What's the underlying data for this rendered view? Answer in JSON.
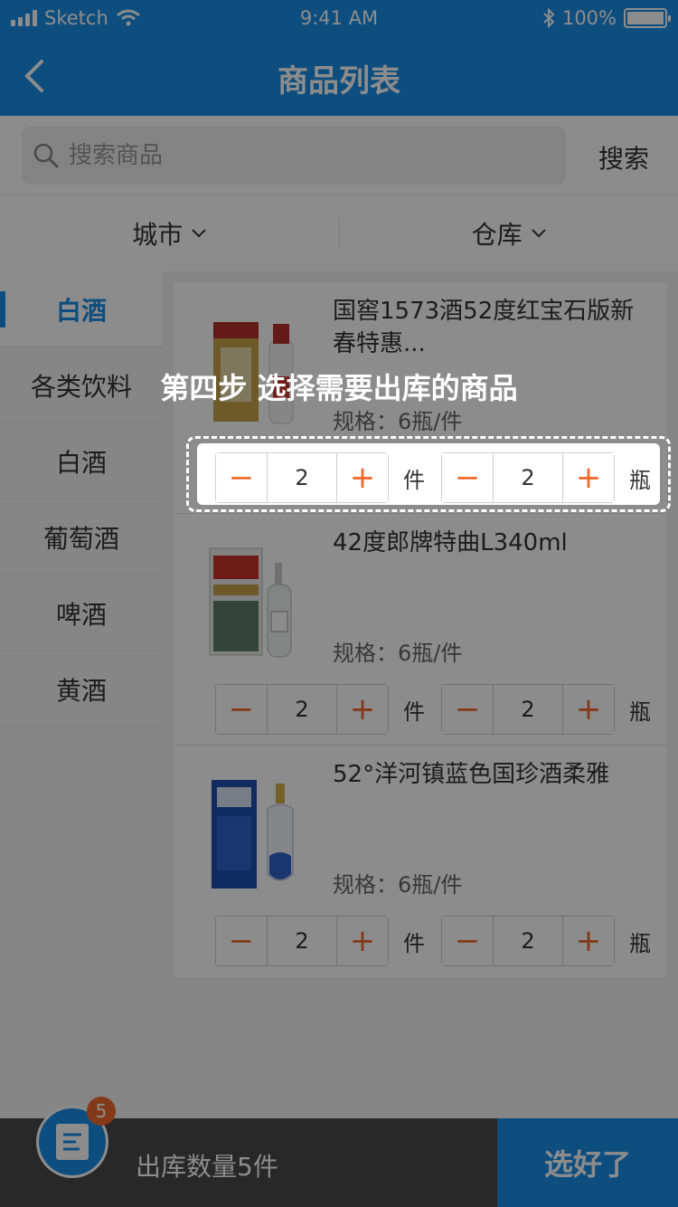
{
  "status": {
    "carrier": "Sketch",
    "time": "9:41 AM",
    "battery": "100%"
  },
  "nav": {
    "title": "商品列表"
  },
  "search": {
    "placeholder": "搜索商品",
    "button_label": "搜索"
  },
  "filters": [
    {
      "label": "城市"
    },
    {
      "label": "仓库"
    }
  ],
  "categories": [
    {
      "label": "白酒",
      "active": true
    },
    {
      "label": "各类饮料"
    },
    {
      "label": "白酒"
    },
    {
      "label": "葡萄酒"
    },
    {
      "label": "啤酒"
    },
    {
      "label": "黄酒"
    }
  ],
  "products": [
    {
      "name": "国窖1573酒52度红宝石版新春特惠...",
      "spec": "规格：6瓶/件",
      "case_qty": "2",
      "case_unit": "件",
      "bottle_qty": "2",
      "bottle_unit": "瓶"
    },
    {
      "name": "42度郎牌特曲L340ml",
      "spec": "规格：6瓶/件",
      "case_qty": "2",
      "case_unit": "件",
      "bottle_qty": "2",
      "bottle_unit": "瓶"
    },
    {
      "name": "52°洋河镇蓝色国珍酒柔雅",
      "spec": "规格：6瓶/件",
      "case_qty": "2",
      "case_unit": "件",
      "bottle_qty": "2",
      "bottle_unit": "瓶"
    }
  ],
  "guide": {
    "text": "第四步 选择需要出库的商品"
  },
  "bottom": {
    "count_label": "出库数量5件",
    "confirm_label": "选好了",
    "cart_badge": "5"
  },
  "colors": {
    "primary": "#1a8fe8",
    "accent": "#f06a2c",
    "bottom_bar": "#4a4a4a"
  }
}
